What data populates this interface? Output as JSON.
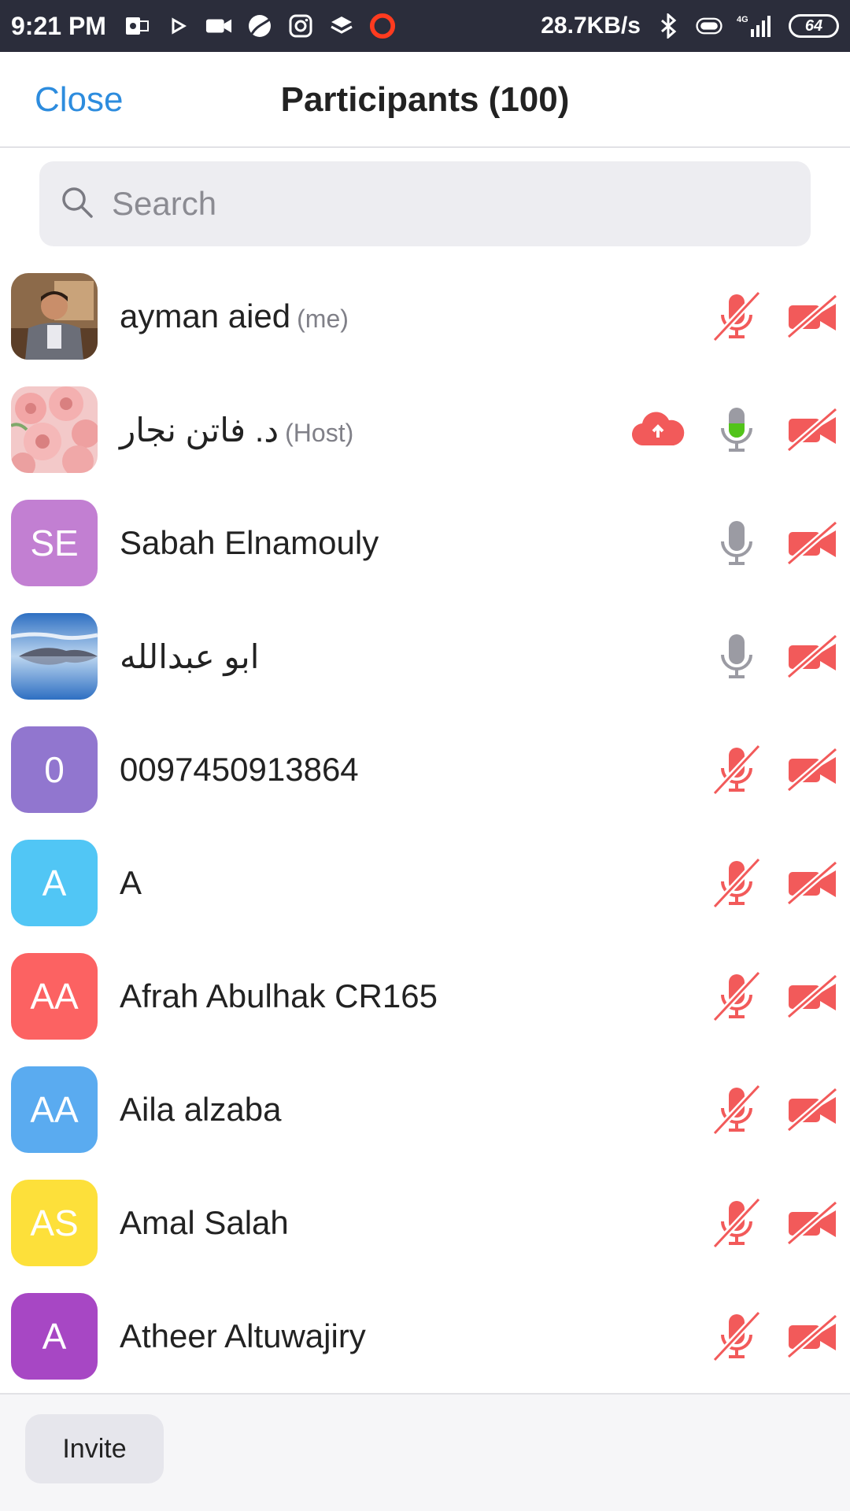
{
  "status_bar": {
    "time": "9:21 PM",
    "speed": "28.7KB/s",
    "network": "4G",
    "battery": "64"
  },
  "header": {
    "close_label": "Close",
    "title": "Participants (100)"
  },
  "search": {
    "placeholder": "Search"
  },
  "participants": [
    {
      "name": "ayman aied",
      "tag": "(me)",
      "initials": "",
      "avatar_color": "",
      "photo": "portrait",
      "mic": "muted",
      "video": "off",
      "recording": false
    },
    {
      "name": "د. فاتن نجار",
      "tag": "(Host)",
      "initials": "",
      "avatar_color": "",
      "photo": "roses",
      "mic": "active",
      "video": "off",
      "recording": true
    },
    {
      "name": "Sabah Elnamouly",
      "tag": "",
      "initials": "SE",
      "avatar_color": "#c27fd2",
      "photo": "",
      "mic": "on",
      "video": "off",
      "recording": false
    },
    {
      "name": "ابو عبدالله",
      "tag": "",
      "initials": "",
      "avatar_color": "",
      "photo": "landscape",
      "mic": "on",
      "video": "off",
      "recording": false
    },
    {
      "name": "0097450913864",
      "tag": "",
      "initials": "0",
      "avatar_color": "#9176cf",
      "photo": "",
      "mic": "muted",
      "video": "off",
      "recording": false
    },
    {
      "name": "A",
      "tag": "",
      "initials": "A",
      "avatar_color": "#51c6f5",
      "photo": "",
      "mic": "muted",
      "video": "off",
      "recording": false
    },
    {
      "name": "Afrah Abulhak CR165",
      "tag": "",
      "initials": "AA",
      "avatar_color": "#fc6262",
      "photo": "",
      "mic": "muted",
      "video": "off",
      "recording": false
    },
    {
      "name": "Aila alzaba",
      "tag": "",
      "initials": "AA",
      "avatar_color": "#5aabf0",
      "photo": "",
      "mic": "muted",
      "video": "off",
      "recording": false
    },
    {
      "name": "Amal Salah",
      "tag": "",
      "initials": "AS",
      "avatar_color": "#fde03a",
      "photo": "",
      "mic": "muted",
      "video": "off",
      "recording": false
    },
    {
      "name": "Atheer Altuwajiry",
      "tag": "",
      "initials": "A",
      "avatar_color": "#a747c4",
      "photo": "",
      "mic": "muted",
      "video": "off",
      "recording": false
    }
  ],
  "footer": {
    "invite_label": "Invite"
  },
  "colors": {
    "accent": "#2d8cde",
    "muted_red": "#f25a5a",
    "active_green": "#52c41a",
    "mic_grey": "#9b9ba3"
  }
}
